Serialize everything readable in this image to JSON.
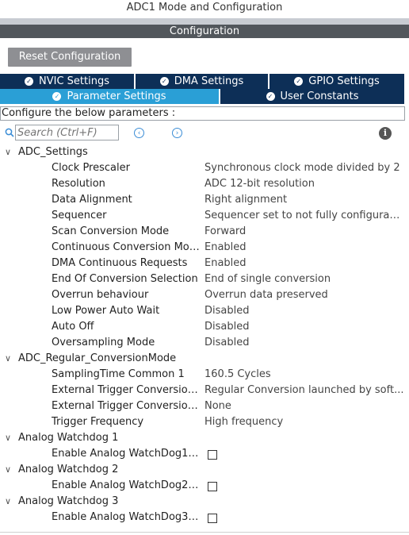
{
  "window": {
    "title": "ADC1 Mode and Configuration"
  },
  "section": {
    "title": "Configuration"
  },
  "reset_button": {
    "label": "Reset Configuration"
  },
  "tabs_row1": [
    {
      "label": "NVIC Settings"
    },
    {
      "label": "DMA Settings"
    },
    {
      "label": "GPIO Settings"
    }
  ],
  "tabs_row2": [
    {
      "label": "Parameter Settings",
      "active": true
    },
    {
      "label": "User Constants",
      "active": false
    }
  ],
  "configure_text": "Configure the below parameters :",
  "search": {
    "placeholder": "Search (Ctrl+F)"
  },
  "groups": [
    {
      "name": "ADC_Settings",
      "params": [
        {
          "label": "Clock Prescaler",
          "value": "Synchronous clock mode divided by 2"
        },
        {
          "label": "Resolution",
          "value": "ADC 12-bit resolution"
        },
        {
          "label": "Data Alignment",
          "value": "Right alignment"
        },
        {
          "label": "Sequencer",
          "value": "Sequencer set to not fully configurable"
        },
        {
          "label": "Scan Conversion Mode",
          "value": "Forward"
        },
        {
          "label": "Continuous Conversion Mode",
          "value": "Enabled"
        },
        {
          "label": "DMA Continuous Requests",
          "value": "Enabled"
        },
        {
          "label": "End Of Conversion Selection",
          "value": "End of single conversion"
        },
        {
          "label": "Overrun behaviour",
          "value": "Overrun data preserved"
        },
        {
          "label": "Low Power Auto Wait",
          "value": "Disabled"
        },
        {
          "label": "Auto Off",
          "value": "Disabled"
        },
        {
          "label": "Oversampling Mode",
          "value": "Disabled"
        }
      ]
    },
    {
      "name": "ADC_Regular_ConversionMode",
      "params": [
        {
          "label": "SamplingTime Common 1",
          "value": "160.5 Cycles"
        },
        {
          "label": "External Trigger Conversion...",
          "value": "Regular Conversion launched by soft..."
        },
        {
          "label": "External Trigger Conversion...",
          "value": "None"
        },
        {
          "label": "Trigger Frequency",
          "value": "High frequency"
        }
      ]
    },
    {
      "name": "Analog Watchdog 1",
      "checkbox": {
        "label": "Enable Analog WatchDog1 ...",
        "checked": false
      }
    },
    {
      "name": "Analog Watchdog 2",
      "checkbox": {
        "label": "Enable Analog WatchDog2 ...",
        "checked": false
      }
    },
    {
      "name": "Analog Watchdog 3",
      "checkbox": {
        "label": "Enable Analog WatchDog3 ...",
        "checked": false
      }
    }
  ],
  "icons": {
    "check": "check-circle-icon",
    "search": "search-icon",
    "prev": "arrow-left-circle-icon",
    "next": "arrow-right-circle-icon",
    "info": "info-icon",
    "expand": "chevron-down-icon"
  },
  "colors": {
    "tab_bg": "#0d2f57",
    "tab_active": "#2a9fd6",
    "section_bar": "#52575c",
    "reset_button": "#8e8f93",
    "accent": "#3b8dd6"
  }
}
